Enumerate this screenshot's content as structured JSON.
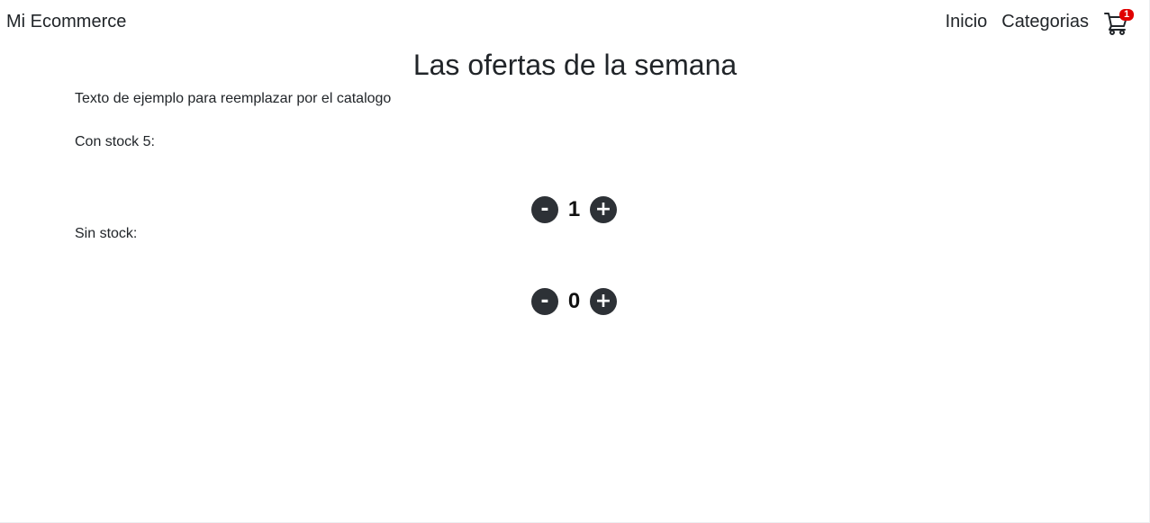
{
  "navbar": {
    "brand": "Mi Ecommerce",
    "links": [
      {
        "label": "Inicio"
      },
      {
        "label": "Categorias"
      }
    ],
    "cart": {
      "icon": "cart-icon",
      "badge_count": "1",
      "badge_color": "#e00000"
    }
  },
  "main": {
    "title": "Las ofertas de la semana",
    "description": "Texto de ejemplo para reemplazar por el catalogo",
    "products": [
      {
        "label": "Con stock 5:",
        "minus_label": "-",
        "count": "1",
        "plus_label": "+"
      },
      {
        "label": "Sin stock:",
        "minus_label": "-",
        "count": "0",
        "plus_label": "+"
      }
    ]
  },
  "colors": {
    "button_bg": "#2d3136",
    "text": "#212529"
  }
}
